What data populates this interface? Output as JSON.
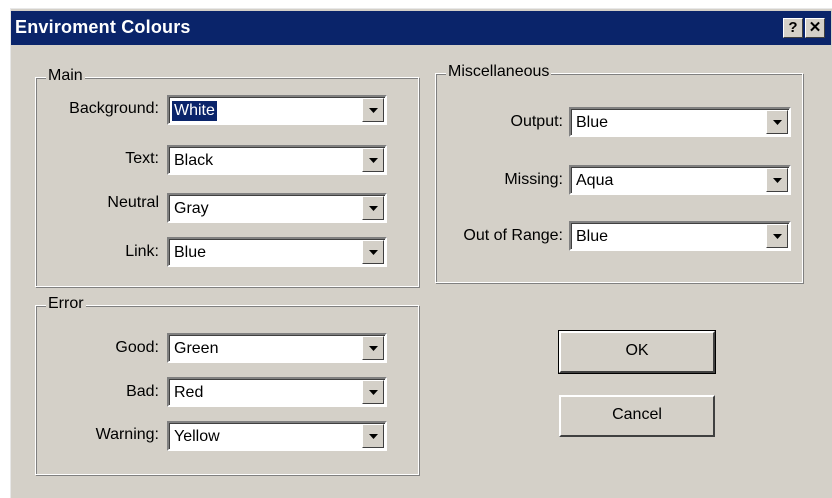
{
  "window": {
    "title": "Enviroment Colours",
    "help_glyph": "?",
    "close_glyph": "✕"
  },
  "main_group": {
    "legend": "Main",
    "fields": [
      {
        "label": "Background:",
        "value": "White"
      },
      {
        "label": "Text:",
        "value": "Black"
      },
      {
        "label": "Neutral",
        "value": "Gray"
      },
      {
        "label": "Link:",
        "value": "Blue"
      }
    ]
  },
  "error_group": {
    "legend": "Error",
    "fields": [
      {
        "label": "Good:",
        "value": "Green"
      },
      {
        "label": "Bad:",
        "value": "Red"
      },
      {
        "label": "Warning:",
        "value": "Yellow"
      }
    ]
  },
  "misc_group": {
    "legend": "Miscellaneous",
    "fields": [
      {
        "label": "Output:",
        "value": "Blue"
      },
      {
        "label": "Missing:",
        "value": "Aqua"
      },
      {
        "label": "Out of Range:",
        "value": "Blue"
      }
    ]
  },
  "buttons": {
    "ok": "OK",
    "cancel": "Cancel"
  },
  "colors": {
    "titlebar": "#0a246a",
    "face": "#d4d0c8",
    "selection": "#0a246a"
  },
  "icons": {
    "help": "help-icon",
    "close": "close-icon",
    "dropdown": "chevron-down-icon"
  }
}
